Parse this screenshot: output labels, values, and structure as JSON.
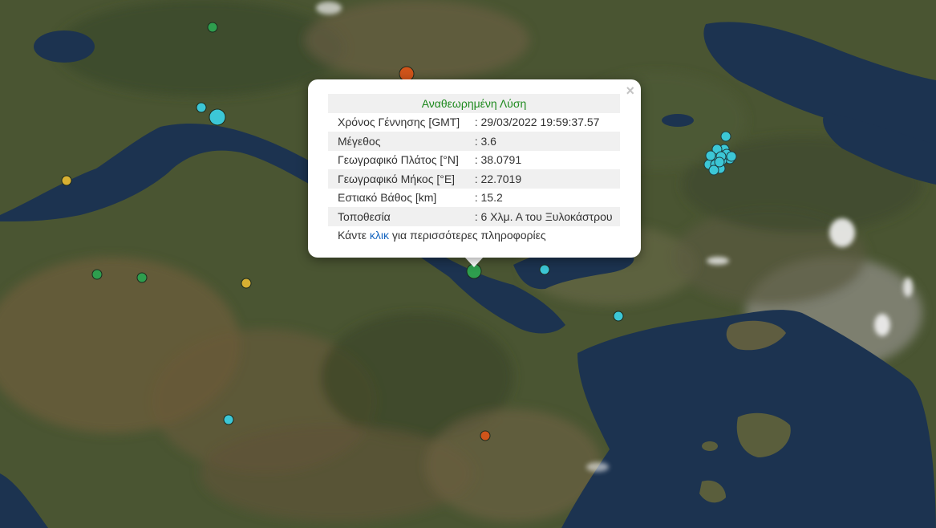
{
  "map": {
    "colors": {
      "land": "#4a5532",
      "land_dark": "#3a4427",
      "land_light": "#7a6a45",
      "sea": "#1c3350",
      "sea_deep": "#132642",
      "city": "#8a8a7e",
      "cloud": "#f2f2f2"
    },
    "markers": [
      {
        "id": "m1",
        "color": "#2e9e4e",
        "size": "small"
      },
      {
        "id": "m2",
        "color": "#d0541a",
        "size": "medium"
      },
      {
        "id": "m3",
        "color": "#3cc7d6",
        "size": "small"
      },
      {
        "id": "m4",
        "color": "#3cc7d6",
        "size": "large"
      },
      {
        "id": "m5",
        "color": "#d8b032",
        "size": "small"
      },
      {
        "id": "m6",
        "color": "#2e9e4e",
        "size": "small"
      },
      {
        "id": "m7",
        "color": "#2e9e4e",
        "size": "small"
      },
      {
        "id": "m8",
        "color": "#d8b032",
        "size": "small"
      },
      {
        "id": "m9",
        "color": "#2e9e4e",
        "size": "medium",
        "selected": true
      },
      {
        "id": "m10",
        "color": "#3cc7d6",
        "size": "small"
      },
      {
        "id": "m11",
        "color": "#3cc7d6",
        "size": "small"
      },
      {
        "id": "m12",
        "color": "#3cc7d6",
        "size": "small"
      },
      {
        "id": "m13",
        "color": "#d0541a",
        "size": "small"
      },
      {
        "id": "cluster",
        "color": "#3cc7d6",
        "size": "small",
        "count": 16
      }
    ]
  },
  "popup": {
    "close_label": "×",
    "title": "Αναθεωρημένη Λύση",
    "rows": [
      {
        "label": "Χρόνος Γέννησης [GMT]",
        "value": ": 29/03/2022 19:59:37.57"
      },
      {
        "label": "Μέγεθος",
        "value": ": 3.6"
      },
      {
        "label": "Γεωγραφικό Πλάτος [°N]",
        "value": ": 38.0791"
      },
      {
        "label": "Γεωγραφικό Μήκος [°E]",
        "value": ": 22.7019"
      },
      {
        "label": "Εστιακό Βάθος [km]",
        "value": ": 15.2"
      },
      {
        "label": "Τοποθεσία",
        "value": ": 6 Χλμ. Α του Ξυλοκάστρου"
      }
    ],
    "footer_before": "Κάντε ",
    "footer_link": "κλικ",
    "footer_after": " για περισσότερες πληροφορίες"
  }
}
